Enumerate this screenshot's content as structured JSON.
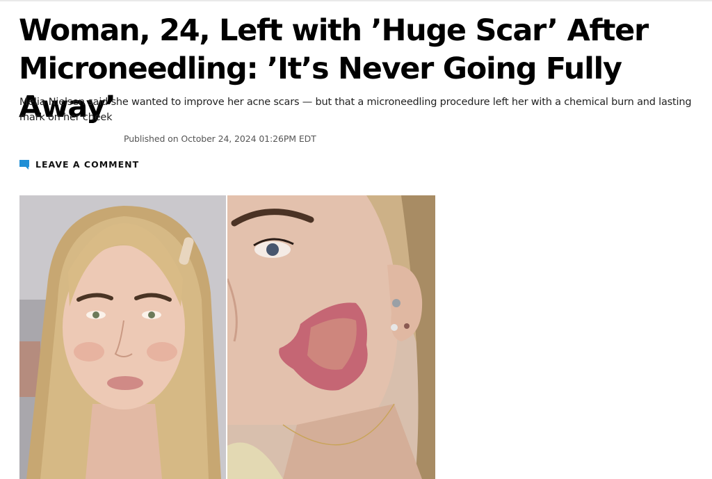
{
  "article": {
    "headline": "Woman, 24, Left with ’Huge Scar’ After Microneedling: ’It’s Never Going Fully Away’",
    "dek": "Melia Nielsen said she wanted to improve her acne scars — but that a microneedling procedure left her with a chemical burn and lasting mark on her cheek",
    "published": "Published on October 24, 2024 01:26PM EDT",
    "comment_label": "LEAVE A COMMENT"
  },
  "colors": {
    "accent": "#1f8fd6",
    "headline": "#000000",
    "burn": "#c0566a"
  },
  "icons": {
    "comment": "comment-bubble-icon"
  }
}
